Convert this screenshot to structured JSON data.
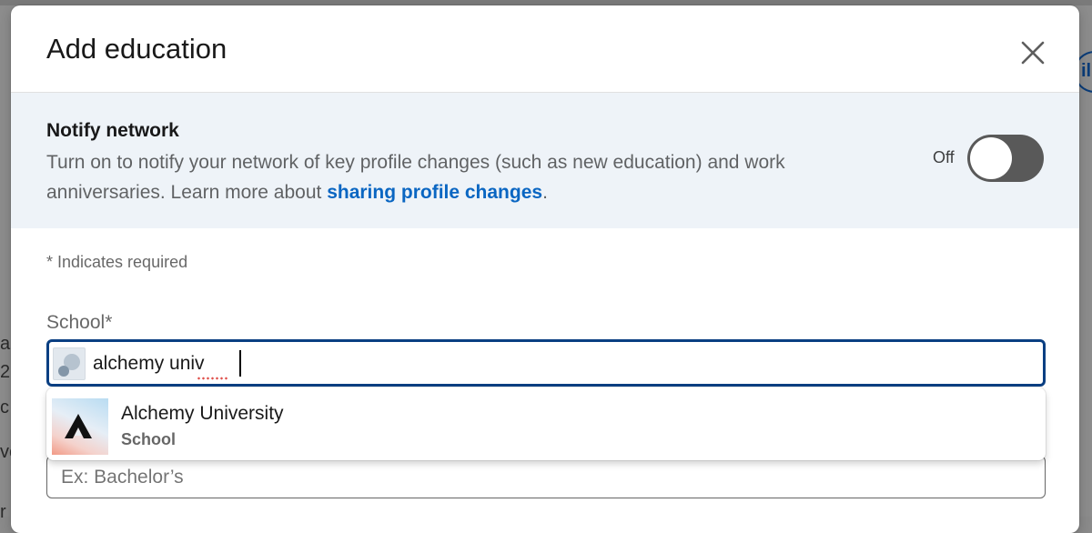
{
  "background": {
    "fragments": [
      "a",
      "2",
      "c",
      "ve",
      "r"
    ],
    "right_button_fragment": "il"
  },
  "modal": {
    "title": "Add education",
    "close_icon": "close-icon"
  },
  "notify": {
    "title": "Notify network",
    "description": "Turn on to notify your network of key profile changes (such as new education) and work anniversaries. Learn more about",
    "link_text": "sharing profile changes",
    "link_suffix": ".",
    "toggle_label": "Off",
    "toggle_on": false
  },
  "form": {
    "required_note": "* Indicates required",
    "school_label": "School*",
    "school_value": "alchemy univ",
    "degree_placeholder": "Ex: Bachelor’s"
  },
  "suggestions": [
    {
      "name": "Alchemy University",
      "type": "School"
    }
  ],
  "colors": {
    "accent": "#0a66c2",
    "focus_border": "#0a3f82",
    "notify_bg": "#eef3f8",
    "toggle_off": "#595959"
  }
}
